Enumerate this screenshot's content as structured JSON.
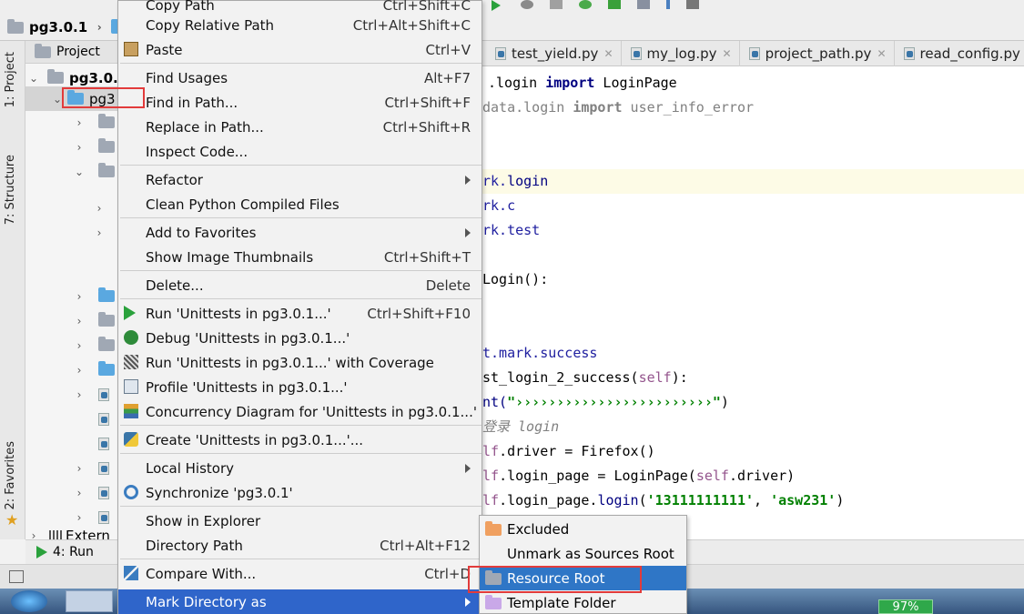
{
  "navbar": {
    "project_name": "pg3.0.1"
  },
  "left_strip": {
    "tab_project": "1: Project",
    "tab_structure": "7: Structure",
    "tab_favorites": "2: Favorites"
  },
  "project_panel": {
    "header": "Project",
    "root_label": "pg3.0.",
    "selected_label": "pg3",
    "external": "Extern"
  },
  "editor_tabs": [
    {
      "label": "test_yield.py"
    },
    {
      "label": "my_log.py"
    },
    {
      "label": "project_path.py"
    },
    {
      "label": "read_config.py"
    }
  ],
  "code": {
    "l1_a": ".login ",
    "l1_kw": "import",
    "l1_b": " LoginPage",
    "l2_a": "data.login ",
    "l2_kw": "import",
    "l2_b": " user_info_error",
    "l3_a": "rk.",
    "l3_b": "login",
    "l4_a": "rk.",
    "l4_b": "c",
    "l5_a": "rk.",
    "l5_b": "test",
    "l6": "Login():",
    "l7": "t.mark.success",
    "l8_a": "st_login_2_success(",
    "l8_b": "self",
    "l8_c": "):",
    "l9_a": "nt(",
    "l9_b": "\"››››››››››››››››››››››››\"",
    "l9_c": ")",
    "l10": "登录 login",
    "l11_a": "lf",
    "l11_b": ".driver = Firefox()",
    "l12_a": "lf",
    "l12_b": ".login_page = LoginPage(",
    "l12_c": "self",
    "l12_d": ".driver)",
    "l13_a": "lf",
    "l13_b": ".login_page.",
    "l13_c": "login",
    "l13_d": "(",
    "l13_e": "'13111111111'",
    "l13_f": ", ",
    "l13_g": "'asw231'",
    "l13_h": ")"
  },
  "context_menu": {
    "copy_path": "Copy Path",
    "copy_path_sc": "Ctrl+Shift+C",
    "copy_relative_path": "Copy Relative Path",
    "copy_relative_path_sc": "Ctrl+Alt+Shift+C",
    "paste": "Paste",
    "paste_sc": "Ctrl+V",
    "find_usages": "Find Usages",
    "find_usages_sc": "Alt+F7",
    "find_in_path": "Find in Path...",
    "find_in_path_sc": "Ctrl+Shift+F",
    "replace_in_path": "Replace in Path...",
    "replace_in_path_sc": "Ctrl+Shift+R",
    "inspect_code": "Inspect Code...",
    "refactor": "Refactor",
    "clean_python": "Clean Python Compiled Files",
    "add_favorites": "Add to Favorites",
    "show_thumbnails": "Show Image Thumbnails",
    "show_thumbnails_sc": "Ctrl+Shift+T",
    "delete": "Delete...",
    "delete_sc": "Delete",
    "run": "Run 'Unittests in pg3.0.1...'",
    "run_sc": "Ctrl+Shift+F10",
    "debug": "Debug 'Unittests in pg3.0.1...'",
    "run_coverage": "Run 'Unittests in pg3.0.1...' with Coverage",
    "profile": "Profile 'Unittests in pg3.0.1...'",
    "concurrency": "Concurrency Diagram for  'Unittests in pg3.0.1...'",
    "create": "Create 'Unittests in pg3.0.1...'...",
    "local_history": "Local History",
    "synchronize": "Synchronize 'pg3.0.1'",
    "show_explorer": "Show in Explorer",
    "directory_path": "Directory Path",
    "directory_path_sc": "Ctrl+Alt+F12",
    "compare_with": "Compare With...",
    "compare_with_sc": "Ctrl+D",
    "mark_directory": "Mark Directory as"
  },
  "submenu": {
    "excluded": "Excluded",
    "unmark": "Unmark as Sources Root",
    "resource_root": "Resource Root",
    "template_folder": "Template Folder"
  },
  "run_bar": {
    "run_tab": "4: Run"
  },
  "taskbar": {
    "battery": "97%"
  },
  "colors": {
    "menu_selection": "#2f65ca",
    "highlight_box": "#e23b3b",
    "run_green": "#2aa13c"
  }
}
